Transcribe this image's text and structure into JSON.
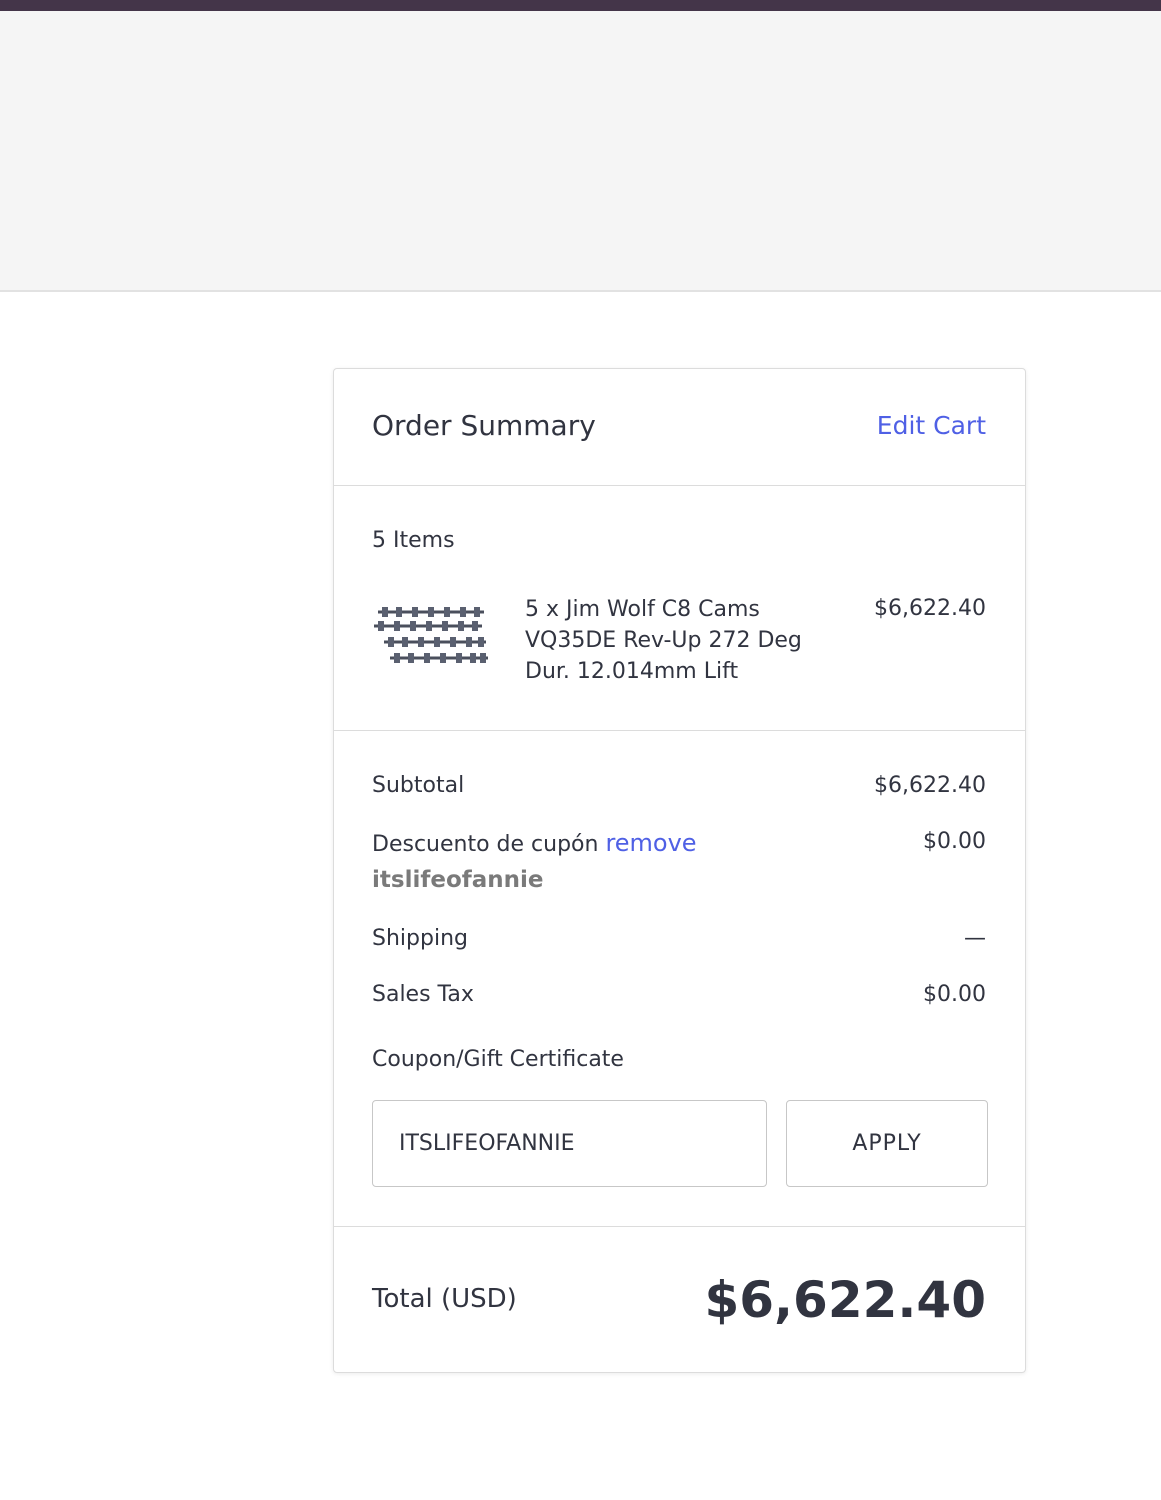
{
  "order_summary": {
    "title": "Order Summary",
    "edit_cart_label": "Edit Cart",
    "item_count": "5 Items",
    "item": {
      "name": "5 x Jim Wolf C8 Cams VQ35DE Rev-Up 272 Deg Dur. 12.014mm Lift",
      "price": "$6,622.40",
      "image_icon": "camshaft-product-image"
    },
    "rows": {
      "subtotal_label": "Subtotal",
      "subtotal_value": "$6,622.40",
      "discount_label": "Descuento de cupón",
      "discount_remove": "remove",
      "discount_code": "itslifeofannie",
      "discount_value": "$0.00",
      "shipping_label": "Shipping",
      "shipping_value": "—",
      "tax_label": "Sales Tax",
      "tax_value": "$0.00"
    },
    "coupon": {
      "label": "Coupon/Gift Certificate",
      "value": "ITSLIFEOFANNIE",
      "apply_label": "APPLY"
    },
    "total": {
      "label": "Total (USD)",
      "value": "$6,622.40"
    }
  },
  "colors": {
    "top_bar": "#443549",
    "link": "#4f60e5",
    "text": "#313440"
  }
}
